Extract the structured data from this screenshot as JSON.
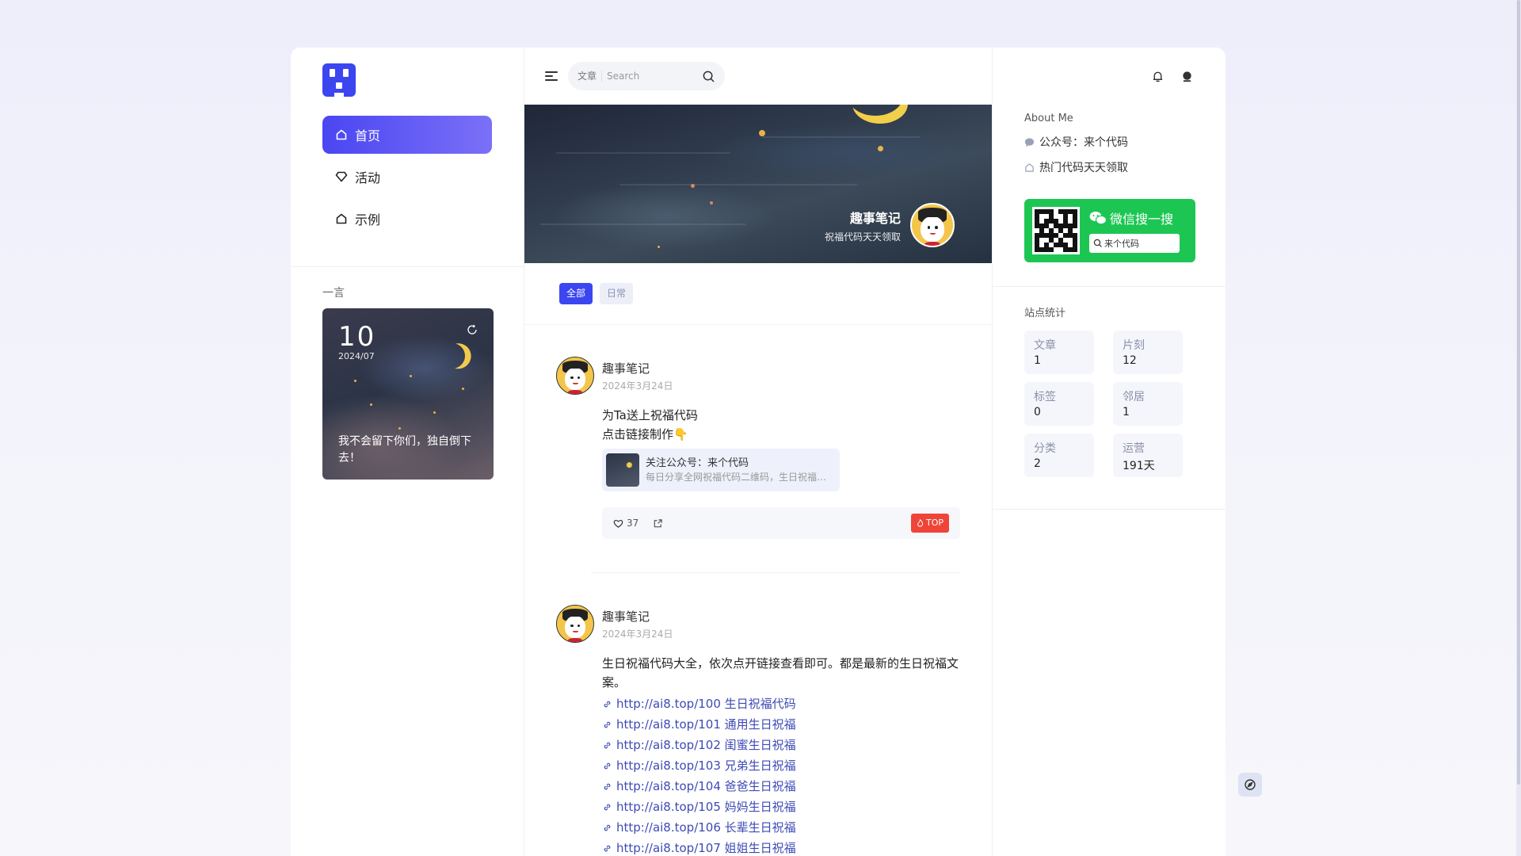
{
  "sidebar": {
    "nav": [
      {
        "label": "首页",
        "icon": "home-icon",
        "active": true
      },
      {
        "label": "活动",
        "icon": "diamond-icon",
        "active": false
      },
      {
        "label": "示例",
        "icon": "home-icon",
        "active": false
      }
    ],
    "quote_title": "一言",
    "quote": {
      "day": "10",
      "year_month": "2024/07",
      "text": "我不会留下你们，独自倒下去！"
    }
  },
  "topbar": {
    "search_scope": "文章",
    "search_placeholder": "Search"
  },
  "banner": {
    "name": "趣事笔记",
    "description": "祝福代码天天领取"
  },
  "filters": [
    {
      "label": "全部",
      "active": true
    },
    {
      "label": "日常",
      "active": false
    }
  ],
  "posts": [
    {
      "author": "趣事笔记",
      "date": "2024年3月24日",
      "lines": [
        "为Ta送上祝福代码",
        "点击链接制作👇"
      ],
      "link_card": {
        "title": "关注公众号：来个代码",
        "description": "每日分享全网祝福代码二维码，生日祝福，表白代码等"
      },
      "likes": "37",
      "badge": "TOP"
    },
    {
      "author": "趣事笔记",
      "date": "2024年3月24日",
      "text": "生日祝福代码大全，依次点开链接查看即可。都是最新的生日祝福文案。",
      "links": [
        "http://ai8.top/100 生日祝福代码",
        "http://ai8.top/101 通用生日祝福",
        "http://ai8.top/102 闺蜜生日祝福",
        "http://ai8.top/103 兄弟生日祝福",
        "http://ai8.top/104 爸爸生日祝福",
        "http://ai8.top/105 妈妈生日祝福",
        "http://ai8.top/106 长辈生日祝福",
        "http://ai8.top/107 姐姐生日祝福"
      ]
    }
  ],
  "right": {
    "about_title": "About Me",
    "about_items": [
      "公众号：来个代码",
      "热门代码天天领取"
    ],
    "wechat": {
      "title": "微信搜一搜",
      "query": "来个代码"
    },
    "stats_title": "站点统计",
    "stats": [
      {
        "key": "文章",
        "value": "1"
      },
      {
        "key": "片刻",
        "value": "12"
      },
      {
        "key": "标签",
        "value": "0"
      },
      {
        "key": "邻居",
        "value": "1"
      },
      {
        "key": "分类",
        "value": "2"
      },
      {
        "key": "运营",
        "value": "191天"
      }
    ]
  },
  "colors": {
    "accent": "#3b46f0",
    "wechat_green": "#1dc653",
    "top_badge": "#f04438",
    "link": "#3d4ab5"
  }
}
